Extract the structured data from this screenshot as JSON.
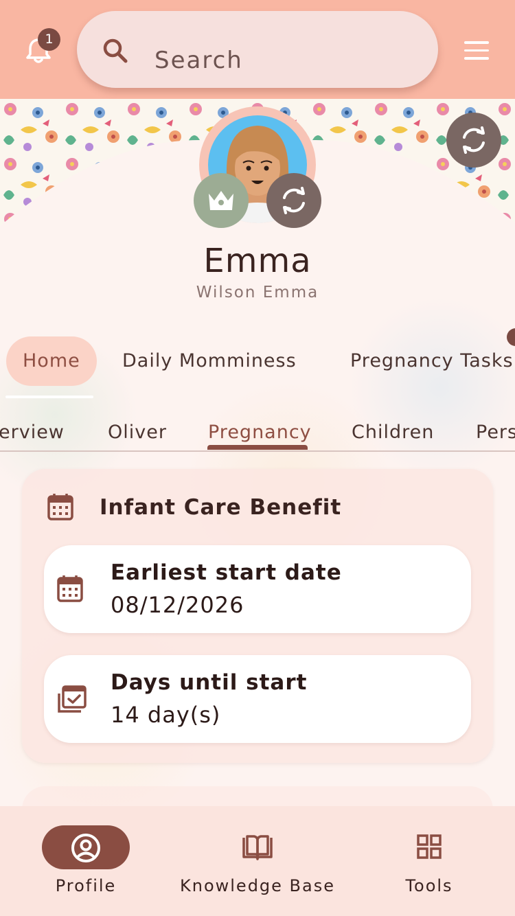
{
  "header": {
    "notification_count": "1",
    "search_placeholder": "Search"
  },
  "profile": {
    "name": "Emma",
    "subname": "Wilson Emma"
  },
  "primary_tabs": [
    {
      "label": "Home",
      "active": true
    },
    {
      "label": "Daily Momminess",
      "active": false
    },
    {
      "label": "Pregnancy Tasks",
      "active": false
    }
  ],
  "secondary_tabs": [
    {
      "label": "erview",
      "active": false
    },
    {
      "label": "Oliver",
      "active": false
    },
    {
      "label": "Pregnancy",
      "active": true
    },
    {
      "label": "Children",
      "active": false
    },
    {
      "label": "Pers",
      "active": false
    }
  ],
  "benefit_card": {
    "title": "Infant Care Benefit",
    "rows": [
      {
        "label": "Earliest start date",
        "value": "08/12/2026",
        "icon": "calendar-icon"
      },
      {
        "label": "Days until start",
        "value": "14 day(s)",
        "icon": "calendar-check-icon"
      }
    ]
  },
  "bottom_nav": [
    {
      "label": "Profile",
      "icon": "profile-icon",
      "active": true
    },
    {
      "label": "Knowledge Base",
      "icon": "book-icon",
      "active": false
    },
    {
      "label": "Tools",
      "icon": "grid-icon",
      "active": false
    }
  ],
  "colors": {
    "header_bg": "#f9b6a2",
    "accent": "#8a4d42",
    "crown_bg": "#9cac94",
    "swap_bg": "#7a6763",
    "nav_bg": "#fbe4de"
  }
}
